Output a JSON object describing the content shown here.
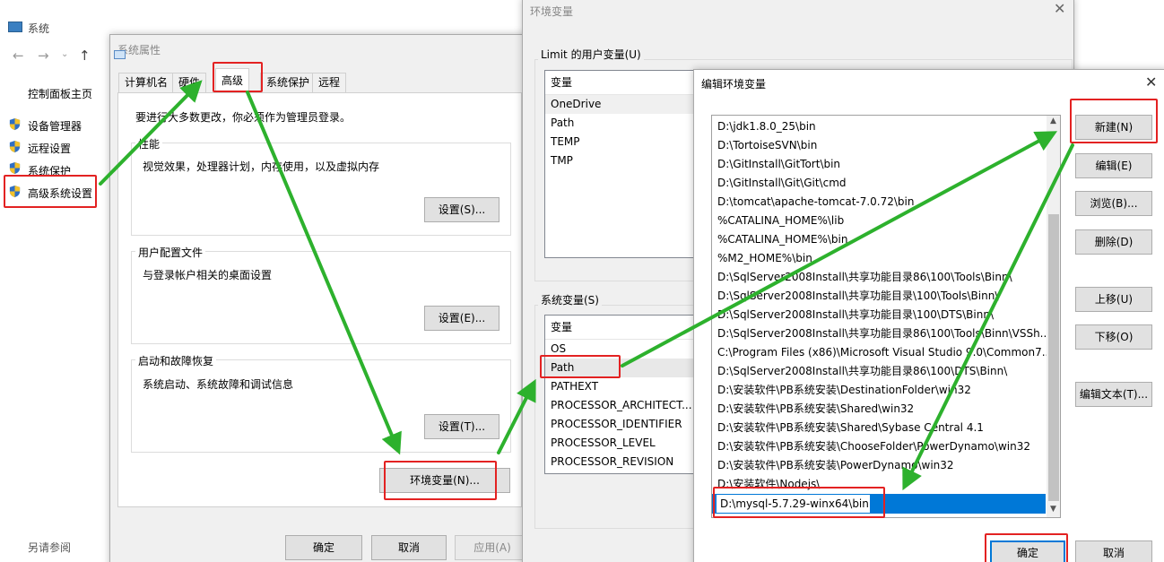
{
  "system_window": {
    "title": "系统",
    "nav": {
      "back": "←",
      "forward": "→",
      "up": "↑"
    },
    "control_panel_home": "控制面板主页",
    "links": [
      "设备管理器",
      "远程设置",
      "系统保护",
      "高级系统设置"
    ],
    "see_also": "另请参阅"
  },
  "system_properties": {
    "title": "系统属性",
    "tabs": [
      "计算机名",
      "硬件",
      "高级",
      "系统保护",
      "远程"
    ],
    "admin_note": "要进行大多数更改，你必须作为管理员登录。",
    "performance": {
      "label": "性能",
      "desc": "视觉效果，处理器计划，内存使用，以及虚拟内存",
      "button": "设置(S)..."
    },
    "user_profiles": {
      "label": "用户配置文件",
      "desc": "与登录帐户相关的桌面设置",
      "button": "设置(E)..."
    },
    "startup_recovery": {
      "label": "启动和故障恢复",
      "desc": "系统启动、系统故障和调试信息",
      "button": "设置(T)..."
    },
    "env_button": "环境变量(N)...",
    "ok": "确定",
    "cancel": "取消",
    "apply": "应用(A)"
  },
  "env_vars": {
    "title": "环境变量",
    "user_group_label": "Limit 的用户变量(U)",
    "user_header": "变量",
    "user_vars": [
      "OneDrive",
      "Path",
      "TEMP",
      "TMP"
    ],
    "system_group_label": "系统变量(S)",
    "system_header": "变量",
    "system_vars": [
      "OS",
      "Path",
      "PATHEXT",
      "PROCESSOR_ARCHITECT...",
      "PROCESSOR_IDENTIFIER",
      "PROCESSOR_LEVEL",
      "PROCESSOR_REVISION"
    ]
  },
  "edit_env": {
    "title": "编辑环境变量",
    "close": "✕",
    "paths": [
      "D:\\jdk1.8.0_25\\bin",
      "D:\\TortoiseSVN\\bin",
      "D:\\GitInstall\\GitTort\\bin",
      "D:\\GitInstall\\Git\\Git\\cmd",
      "D:\\tomcat\\apache-tomcat-7.0.72\\bin",
      "%CATALINA_HOME%\\lib",
      "%CATALINA_HOME%\\bin",
      "%M2_HOME%\\bin",
      "D:\\SqlServer2008Install\\共享功能目录86\\100\\Tools\\Binn\\",
      "D:\\SqlServer2008Install\\共享功能目录\\100\\Tools\\Binn\\",
      "D:\\SqlServer2008Install\\共享功能目录\\100\\DTS\\Binn\\",
      "D:\\SqlServer2008Install\\共享功能目录86\\100\\Tools\\Binn\\VSSh...",
      "C:\\Program Files (x86)\\Microsoft Visual Studio 9.0\\Common7...",
      "D:\\SqlServer2008Install\\共享功能目录86\\100\\DTS\\Binn\\",
      "D:\\安装软件\\PB系统安装\\DestinationFolder\\win32",
      "D:\\安装软件\\PB系统安装\\Shared\\win32",
      "D:\\安装软件\\PB系统安装\\Shared\\Sybase Central 4.1",
      "D:\\安装软件\\PB系统安装\\ChooseFolder\\PowerDynamo\\win32",
      "D:\\安装软件\\PB系统安装\\PowerDynamo\\win32",
      "D:\\安装软件\\Nodejs\\"
    ],
    "editing_value": "D:\\mysql-5.7.29-winx64\\bin",
    "buttons": {
      "new": "新建(N)",
      "edit": "编辑(E)",
      "browse": "浏览(B)...",
      "delete": "删除(D)",
      "move_up": "上移(U)",
      "move_down": "下移(O)",
      "edit_text": "编辑文本(T)..."
    },
    "ok": "确定",
    "cancel": "取消"
  },
  "colors": {
    "highlight": "#e32222",
    "arrow": "#2db12d",
    "selection": "#0078d7"
  }
}
